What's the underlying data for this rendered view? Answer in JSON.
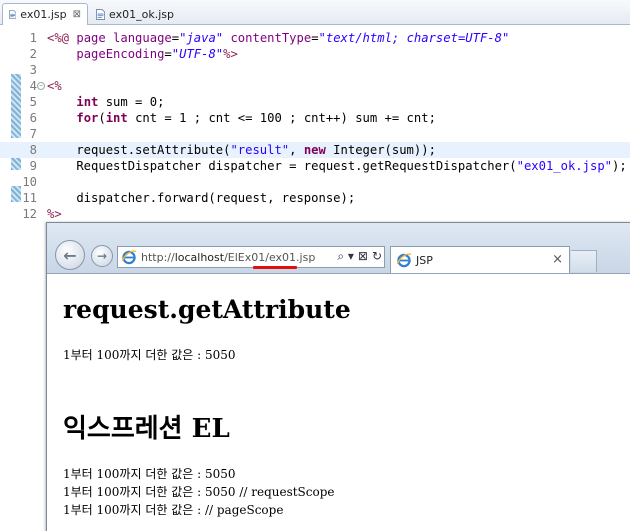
{
  "editor_tabs": [
    {
      "label": "ex01.jsp",
      "close": "⊠"
    },
    {
      "label": "ex01_ok.jsp"
    }
  ],
  "code_lines": [
    {
      "n": "1",
      "parts": [
        [
          "tag",
          "<%@ "
        ],
        [
          "attr",
          "page "
        ],
        [
          "attr",
          "language"
        ],
        [
          "plain",
          "="
        ],
        [
          "str",
          "\"java\""
        ],
        [
          "plain",
          " "
        ],
        [
          "attr",
          "contentType"
        ],
        [
          "plain",
          "="
        ],
        [
          "str",
          "\"text/html; charset=UTF-8\""
        ]
      ]
    },
    {
      "n": "2",
      "parts": [
        [
          "plain",
          "    "
        ],
        [
          "attr",
          "pageEncoding"
        ],
        [
          "plain",
          "="
        ],
        [
          "str",
          "\"UTF-8\""
        ],
        [
          "tag",
          "%>"
        ]
      ]
    },
    {
      "n": "3",
      "parts": []
    },
    {
      "n": "4",
      "parts": [
        [
          "tag",
          "<%"
        ]
      ]
    },
    {
      "n": "5",
      "parts": [
        [
          "plain",
          "    "
        ],
        [
          "kw",
          "int"
        ],
        [
          "plain",
          " sum = 0;"
        ]
      ]
    },
    {
      "n": "6",
      "parts": [
        [
          "plain",
          "    "
        ],
        [
          "kw",
          "for"
        ],
        [
          "plain",
          "("
        ],
        [
          "kw",
          "int"
        ],
        [
          "plain",
          " cnt = 1 ; cnt <= 100 ; cnt++) sum += cnt;"
        ]
      ]
    },
    {
      "n": "7",
      "parts": []
    },
    {
      "n": "8",
      "parts": [
        [
          "plain",
          "    request.setAttribute("
        ],
        [
          "lit",
          "\"result\""
        ],
        [
          "plain",
          ", "
        ],
        [
          "kw",
          "new"
        ],
        [
          "plain",
          " Integer(sum));"
        ]
      ]
    },
    {
      "n": "9",
      "parts": [
        [
          "plain",
          "    RequestDispatcher dispatcher = request.getRequestDispatcher("
        ],
        [
          "lit",
          "\"ex01_ok.jsp\""
        ],
        [
          "plain",
          ");"
        ]
      ]
    },
    {
      "n": "10",
      "parts": []
    },
    {
      "n": "11",
      "parts": [
        [
          "plain",
          "    dispatcher.forward(request, response);"
        ]
      ]
    },
    {
      "n": "12",
      "parts": [
        [
          "tag",
          "%>"
        ]
      ]
    }
  ],
  "browser": {
    "url_prefix": "http://",
    "url_host": "localhost",
    "url_path": "/ElEx01/ex01.jsp",
    "addr_tools": [
      "⌕ ▾",
      "⊠",
      "↻"
    ],
    "back_glyph": "←",
    "forward_glyph": "→",
    "tab_title": "JSP",
    "tab_close": "×"
  },
  "page": {
    "heading1": "request.getAttribute",
    "line1": "1부터 100까지 더한 값은 : 5050",
    "heading2": "익스프레션 EL",
    "line2": "1부터 100까지 더한 값은 : 5050",
    "line3": "1부터 100까지 더한 값은 : 5050 // requestScope",
    "line4": "1부터 100까지 더한 값은 : // pageScope"
  },
  "colors": {
    "jsp_tag": "#8b2252",
    "attr": "#7f007f",
    "string": "#2a00ff",
    "keyword": "#7f0055",
    "highlight_line": "#e8f2fe",
    "url_underline": "#e01010"
  }
}
